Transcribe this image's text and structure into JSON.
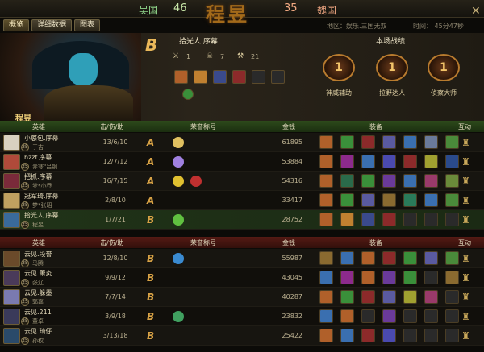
{
  "topbar": {
    "team_left": "吴国",
    "score_left": "46",
    "logo": "程昱",
    "score_right": "35",
    "team_right": "魏国",
    "close_icon": "✕"
  },
  "tabs": [
    "概览",
    "详细数据",
    "图表"
  ],
  "info": {
    "mode": "地区：娱乐.三国无双",
    "time": "时间：   45分47秒"
  },
  "self": {
    "grade": "B",
    "name": "拾光人.序幕",
    "kills": "1",
    "deaths": "7",
    "assists": "21",
    "kill_icon": "crossed-swords-icon",
    "death_icon": "skull-icon",
    "assist_icon": "crossed-hammers-icon"
  },
  "summary": {
    "title": "本场战绩",
    "medals": [
      {
        "rank": "1",
        "label": "神威辅助"
      },
      {
        "rank": "1",
        "label": "拉野达人"
      },
      {
        "rank": "1",
        "label": "侦察大师"
      }
    ]
  },
  "team_name": "程昱",
  "headers": {
    "hero": "英雄",
    "kda": "击/伤/助",
    "honor": "荣誉称号",
    "gold": "金钱",
    "equip": "装备",
    "interact": "互动"
  },
  "team1": [
    {
      "name": "小憨包.序幕",
      "hero": "于吉",
      "level": "25",
      "kda": "13/6/10",
      "grade": "A",
      "gold": "61895",
      "honors": [
        "#e0c060"
      ],
      "color": "#d8d0c0",
      "equip": [
        "#b0602a",
        "#3a8f3a",
        "#8c2a2a",
        "#5a5aa0",
        "#3a6fb0",
        "#6a7a9a",
        "#4a8a3a"
      ]
    },
    {
      "name": "hzzf.序幕",
      "hero": "赤寒\"吕钢",
      "level": "25",
      "kda": "12/7/12",
      "grade": "A",
      "gold": "53884",
      "honors": [
        "#a080e0"
      ],
      "color": "#b04a3a",
      "equip": [
        "#b0602a",
        "#8c2a8c",
        "#3a6fb0",
        "#4a4ab0",
        "#8c2a2a",
        "#a0a030",
        "#2a4a8c"
      ]
    },
    {
      "name": "把抓.序幕",
      "hero": "梦*小乔",
      "level": "25",
      "kda": "16/7/15",
      "grade": "A",
      "gold": "54316",
      "honors": [
        "#e0c030",
        "#c03030"
      ],
      "color": "#7a2a3a",
      "equip": [
        "#b0602a",
        "#2a6a4a",
        "#3a8f3a",
        "#6a3a9a",
        "#3a6fb0",
        "#9a3a6a",
        "#6a8a3a"
      ]
    },
    {
      "name": "冠军琦.序幕",
      "hero": "梦*张昭",
      "level": "25",
      "kda": "2/8/10",
      "grade": "A",
      "gold": "33417",
      "honors": [],
      "color": "#c0a060",
      "equip": [
        "#b0602a",
        "#3a8f3a",
        "#5a5aa0",
        "#8a6a30",
        "#2a7a5a",
        "#3a6fb0",
        "#4a8a3a"
      ]
    },
    {
      "name": "拾光人.序幕",
      "hero": "程昱",
      "level": "25",
      "kda": "1/7/21",
      "grade": "B",
      "gold": "28752",
      "honors": [
        "#60c040"
      ],
      "color": "#3a6a9a",
      "equip": [
        "#b0602a",
        "#c08030",
        "#3a4a8c",
        "#8c2a2a",
        "#2a2a2a",
        "#2a2a2a",
        "#2a2a2a"
      ]
    }
  ],
  "team2": [
    {
      "name": "云见.段誉",
      "hero": "马腾",
      "level": "25",
      "kda": "12/8/10",
      "grade": "B",
      "gold": "55987",
      "honors": [
        "#3a8ad0"
      ],
      "color": "#6a4a2a",
      "equip": [
        "#8a6a30",
        "#3a6fb0",
        "#b0602a",
        "#8c2a2a",
        "#3a8f3a",
        "#5a5aa0",
        "#4a8a3a"
      ]
    },
    {
      "name": "云见.萧炎",
      "hero": "张辽",
      "level": "25",
      "kda": "9/9/12",
      "grade": "B",
      "gold": "43045",
      "honors": [],
      "color": "#4a3a5a",
      "equip": [
        "#3a6fb0",
        "#8c2a8c",
        "#b0602a",
        "#6a3a9a",
        "#3a8f3a",
        "#2a2a2a",
        "#8a6a30"
      ]
    },
    {
      "name": "云见.躲墨",
      "hero": "郭嘉",
      "level": "25",
      "kda": "7/7/14",
      "grade": "B",
      "gold": "40287",
      "honors": [],
      "color": "#7a7ab0",
      "equip": [
        "#b0602a",
        "#3a8f3a",
        "#8c2a2a",
        "#5a5aa0",
        "#a0a030",
        "#9a3a6a",
        "#2a2a2a"
      ]
    },
    {
      "name": "云见.211",
      "hero": "董卓",
      "level": "25",
      "kda": "3/9/18",
      "grade": "B",
      "gold": "23832",
      "honors": [
        "#40a060"
      ],
      "color": "#3a3a5a",
      "equip": [
        "#3a6fb0",
        "#b0602a",
        "#2a2a2a",
        "#6a3a9a",
        "#2a2a2a",
        "#2a2a2a",
        "#2a2a2a"
      ]
    },
    {
      "name": "云见.琦仔",
      "hero": "孙权",
      "level": "25",
      "kda": "3/13/18",
      "grade": "B",
      "gold": "25422",
      "honors": [],
      "color": "#2a4a6a",
      "equip": [
        "#b0602a",
        "#3a6fb0",
        "#8c2a2a",
        "#4a4ab0",
        "#2a2a2a",
        "#2a2a2a",
        "#2a2a2a"
      ]
    }
  ],
  "self_items": [
    "#b0602a",
    "#c08030",
    "#3a4a8c",
    "#8c2a2a",
    "#2a2a2a",
    "#2a2a2a"
  ],
  "interact_icon": "gift-icon"
}
